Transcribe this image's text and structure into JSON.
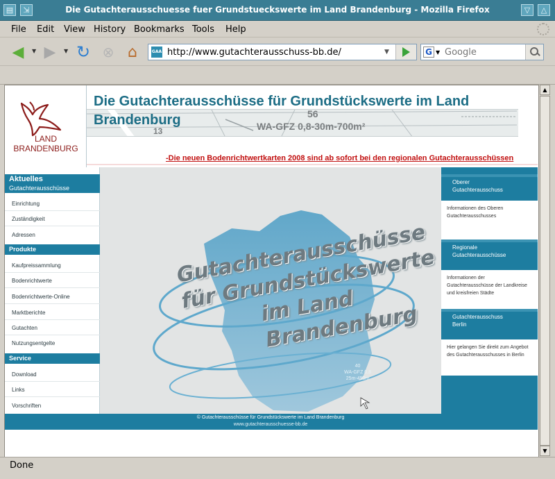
{
  "window": {
    "title": "Die Gutachterausschuesse fuer Grundstueckswerte im Land Brandenburg - Mozilla Firefox"
  },
  "menu": {
    "items": [
      "File",
      "Edit",
      "View",
      "History",
      "Bookmarks",
      "Tools",
      "Help"
    ]
  },
  "navigation": {
    "url": "http://www.gutachterausschuss-bb.de/",
    "favicon_text": "GAA",
    "search_placeholder": "Google",
    "search_engine_letter": "G"
  },
  "status": {
    "text": "Done"
  },
  "page": {
    "logo": {
      "line1": "LAND",
      "line2": "BRANDENBURG"
    },
    "header": {
      "title": "Die Gutachterausschüsse für Grundstückswerte im Land Brandenburg",
      "map_labels": [
        "56",
        "WA-GFZ 0,8-30m-700m²",
        "13"
      ],
      "ticker": "-Die neuen Bodenrichtwertkarten 2008 sind ab sofort bei den regionalen Gutachterausschüssen"
    },
    "leftnav": {
      "sections": [
        {
          "title": "Aktuelles",
          "subtitle": "Gutachterausschüsse",
          "links": [
            "Einrichtung",
            "Zuständigkeit",
            "Adressen"
          ]
        },
        {
          "title": "Produkte",
          "links": [
            "Kaufpreissammlung",
            "Bodenrichtwerte",
            "Bodenrichtwerte-Online",
            "Marktberichte",
            "Gutachten",
            "Nutzungsentgelte"
          ]
        },
        {
          "title": "Service",
          "links": [
            "Download",
            "Links",
            "Vorschriften"
          ]
        }
      ]
    },
    "center": {
      "banner_lines": [
        "Gutachterausschüsse",
        "für Grundstückswerte",
        "im Land",
        "Brandenburg"
      ],
      "map_tag": [
        "40",
        "WA-GFZ 0,8",
        "25m-450m"
      ],
      "footer_line1": "© Gutachterausschüsse für Grundstückswerte im Land Brandenburg",
      "footer_line2": "www.gutachterausschuesse-bb.de"
    },
    "rightpanel": {
      "boxes": [
        {
          "head": [
            "Oberer",
            "Gutachterausschuss"
          ],
          "body": "Informationen des Oberen Gutachterausschusses"
        },
        {
          "head": [
            "Regionale",
            "Gutachterausschüsse"
          ],
          "body": "Informationen der Gutachterausschüsse der Landkreise und kreisfreien Städte"
        },
        {
          "head": [
            "Gutachterausschuss",
            "Berlin"
          ],
          "body": "Hier gelangen Sie direkt zum Angebot des Gutachterausschusses in Berlin"
        }
      ]
    }
  },
  "colors": {
    "brand_teal": "#1d7da0",
    "title_teal": "#1c6d85",
    "ticker_red": "#c10f0f",
    "logo_red": "#8c1c1a",
    "window_title_bg": "#3a7d94"
  },
  "icons": {
    "back": "back-arrow-icon",
    "forward": "forward-arrow-icon",
    "reload": "reload-icon",
    "stop": "stop-icon",
    "home": "home-icon",
    "go": "go-arrow-icon",
    "search": "magnifier-icon",
    "throbber": "throbber-icon"
  }
}
